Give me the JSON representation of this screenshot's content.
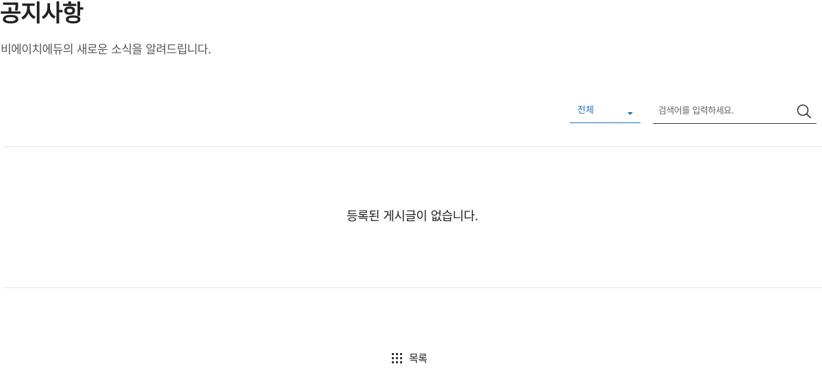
{
  "header": {
    "title": "공지사항",
    "subtitle": "비에이치에듀의 새로운 소식을 알려드립니다."
  },
  "filter": {
    "category_selected": "전체",
    "search_placeholder": "검색어를 입력하세요.",
    "search_value": "",
    "search_icon": "search-icon"
  },
  "board": {
    "empty_message": "등록된 게시글이 없습니다."
  },
  "footer": {
    "list_button_label": "목록",
    "list_icon": "grid-icon"
  },
  "colors": {
    "accent": "#1c6fb6",
    "text": "#222222",
    "muted": "#555555",
    "divider": "#e2e2e2"
  }
}
